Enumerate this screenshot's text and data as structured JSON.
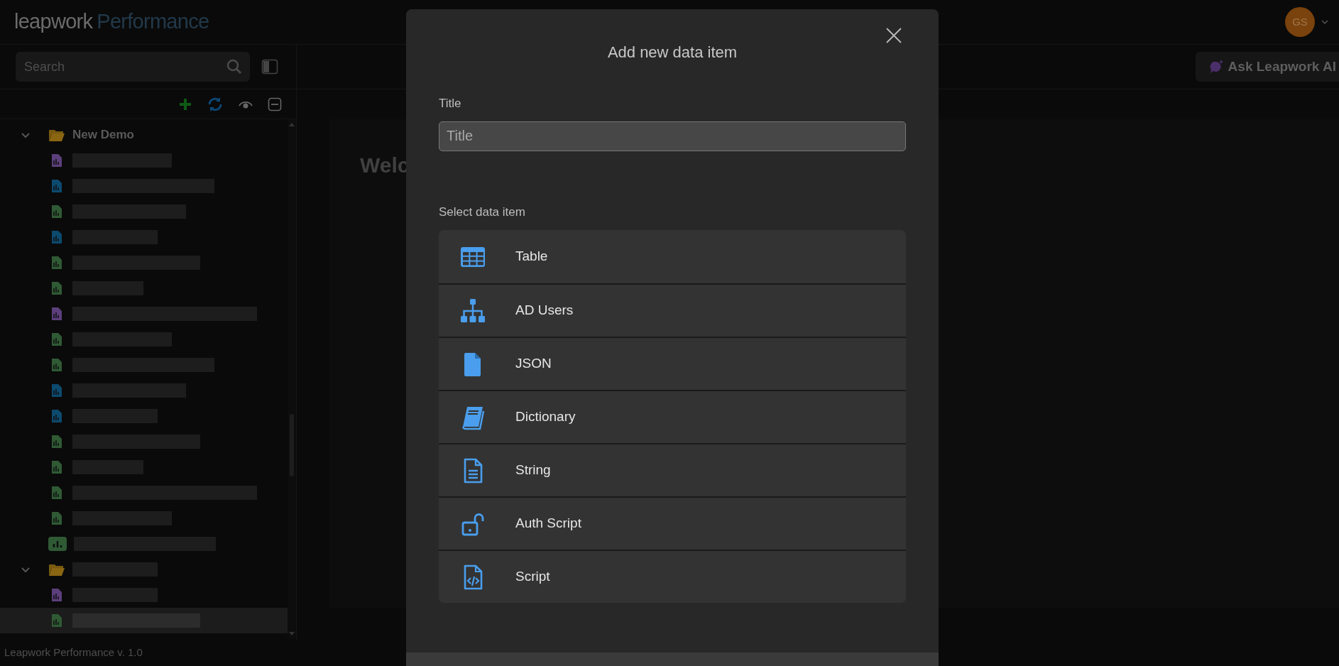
{
  "header": {
    "logo_primary": "leapwork",
    "logo_secondary": "Performance",
    "avatar": "GS"
  },
  "sidebar": {
    "search": {
      "placeholder": "Search"
    },
    "tree": [
      {
        "kind": "folder",
        "label": "New Demo",
        "expanded": true,
        "selected": false,
        "children": [
          {
            "kind": "file",
            "color": "#5b3f7a",
            "selected": false
          },
          {
            "kind": "file",
            "color": "#0c4a6e",
            "selected": false
          },
          {
            "kind": "file",
            "color": "#2f5a34",
            "selected": false
          },
          {
            "kind": "file",
            "color": "#0c4a6e",
            "selected": false
          },
          {
            "kind": "file",
            "color": "#2f5a34",
            "selected": false
          },
          {
            "kind": "file",
            "color": "#2f5a34",
            "selected": false
          },
          {
            "kind": "file",
            "color": "#5b3f7a",
            "selected": false
          },
          {
            "kind": "file",
            "color": "#2f5a34",
            "selected": false
          },
          {
            "kind": "file",
            "color": "#2f5a34",
            "selected": false
          },
          {
            "kind": "file",
            "color": "#0c4a6e",
            "selected": false
          },
          {
            "kind": "file",
            "color": "#0c4a6e",
            "selected": false
          },
          {
            "kind": "file",
            "color": "#2f5a34",
            "selected": false
          },
          {
            "kind": "file",
            "color": "#2f5a34",
            "selected": false
          },
          {
            "kind": "file",
            "color": "#2f5a34",
            "selected": false
          },
          {
            "kind": "file",
            "color": "#2f5a34",
            "selected": false
          },
          {
            "kind": "chart",
            "color": "#2f5a34",
            "selected": false
          }
        ]
      },
      {
        "kind": "folder",
        "expanded": true,
        "selected": false,
        "children": [
          {
            "kind": "file",
            "color": "#5b3f7a",
            "selected": false
          },
          {
            "kind": "file",
            "color": "#2f5a34",
            "selected": true
          }
        ]
      }
    ]
  },
  "main": {
    "ask_button": "Ask Leapwork AI",
    "heading": "Welc"
  },
  "footer": "Leapwork Performance v. 1.0",
  "dialog": {
    "title": "Add new data item",
    "title_label": "Title",
    "title_field": {
      "placeholder": "Title"
    },
    "select_label": "Select data item",
    "items": [
      {
        "kind": "table",
        "label": "Table"
      },
      {
        "kind": "hierarchy",
        "label": "AD Users"
      },
      {
        "kind": "json",
        "label": "JSON"
      },
      {
        "kind": "book",
        "label": "Dictionary"
      },
      {
        "kind": "document",
        "label": "String"
      },
      {
        "kind": "unlock",
        "label": "Auth Script"
      },
      {
        "kind": "code",
        "label": "Script"
      }
    ]
  }
}
